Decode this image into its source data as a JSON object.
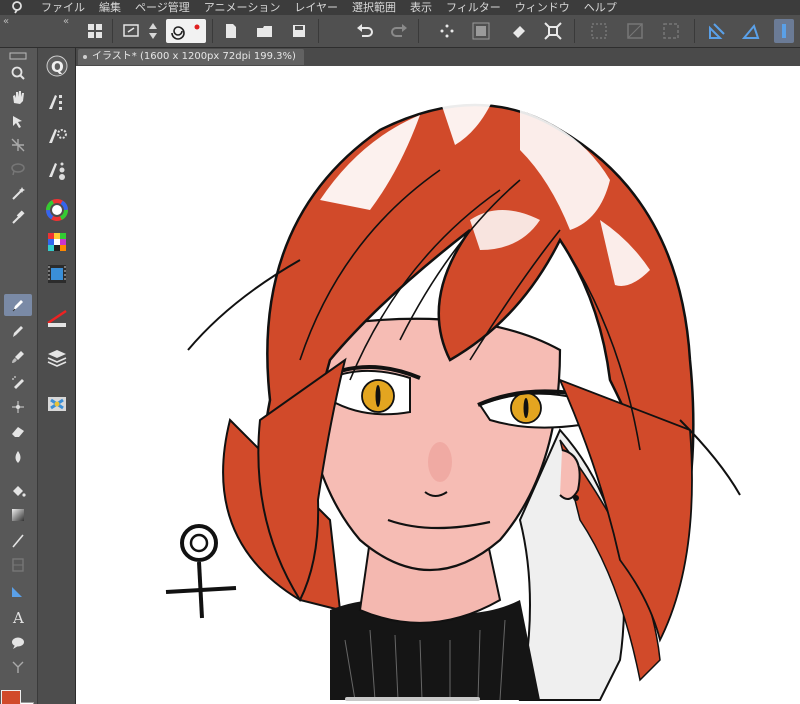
{
  "menu": {
    "items": [
      "ファイル",
      "編集",
      "ページ管理",
      "アニメーション",
      "レイヤー",
      "選択範囲",
      "表示",
      "フィルター",
      "ウィンドウ",
      "ヘルプ"
    ]
  },
  "document": {
    "tab_title": "イラスト* (1600 x 1200px 72dpi 199.3%)"
  },
  "toolbar": {
    "icons": [
      "grid-icon",
      "navigator-icon",
      "up-down-arrows-icon",
      "spiral-icon",
      "new-file-icon",
      "open-folder-icon",
      "save-icon",
      "undo-icon",
      "redo-icon",
      "snap-icon",
      "transform-icon",
      "clear-icon",
      "fit-icon",
      "deselect-icon",
      "invert-icon",
      "ruler-snap-icon",
      "perspective-icon"
    ]
  },
  "tools": {
    "icons": [
      "zoom-icon",
      "hand-icon",
      "move-icon",
      "transform-layer-icon",
      "lasso-icon",
      "magic-wand-icon",
      "eyedropper-icon",
      "pen-icon",
      "pencil-icon",
      "brush-icon",
      "airbrush-icon",
      "decoration-icon",
      "eraser-icon",
      "blend-icon",
      "fill-icon",
      "gradient-icon",
      "line-icon",
      "frame-icon",
      "ruler-icon",
      "text-icon",
      "balloon-icon",
      "correction-icon"
    ],
    "active": "pen-icon"
  },
  "subpanel": {
    "icons": [
      "q-icon",
      "sub-tool-icon",
      "tool-property-icon",
      "brush-size-icon",
      "color-wheel-icon",
      "color-set-icon",
      "timeline-icon",
      "layer-property-icon",
      "layers-icon",
      "material-icon"
    ]
  },
  "colors": {
    "main": "#d14a2a",
    "sub": "#ffffff",
    "accent": "#7a8aa6"
  }
}
